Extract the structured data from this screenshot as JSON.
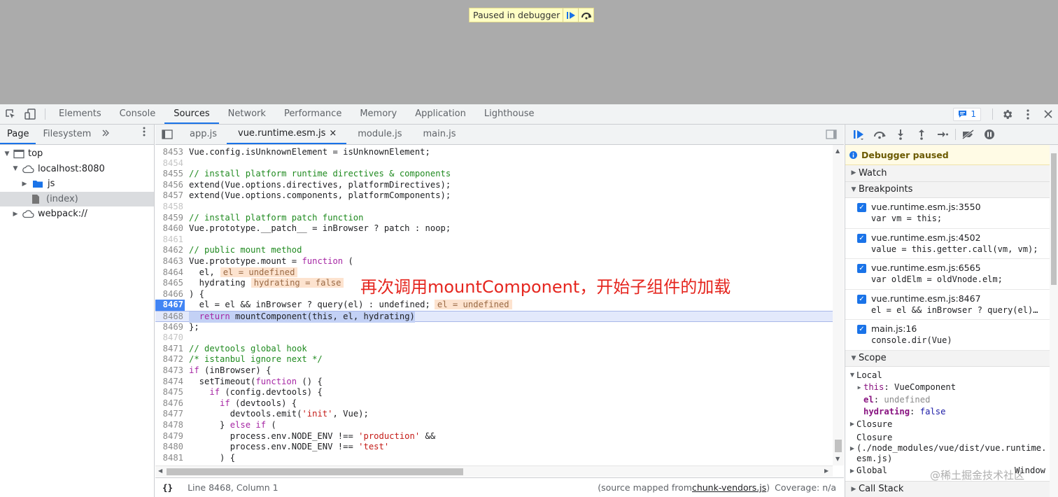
{
  "page": {
    "paused_label": "Paused in debugger"
  },
  "devtools": {
    "tabs": [
      "Elements",
      "Console",
      "Sources",
      "Network",
      "Performance",
      "Memory",
      "Application",
      "Lighthouse"
    ],
    "issues_count": "1"
  },
  "navigator": {
    "tabs": [
      "Page",
      "Filesystem"
    ],
    "tree": {
      "top": "top",
      "host": "localhost:8080",
      "js": "js",
      "index": "(index)",
      "webpack": "webpack://"
    }
  },
  "editor": {
    "tabs": [
      "app.js",
      "vue.runtime.esm.js",
      "module.js",
      "main.js"
    ],
    "annotation": "再次调用mountComponent，开始子组件的加载",
    "inline_values": {
      "el": "el = undefined",
      "hydrating": "hydrating = false",
      "el_8467": "el = undefined"
    },
    "status": {
      "position": "Line 8468, Column 1",
      "mapped_prefix": "(source mapped from ",
      "mapped_file": "chunk-vendors.js",
      "mapped_suffix": ")",
      "coverage": "Coverage: n/a"
    }
  },
  "code_lines": [
    {
      "n": "8453",
      "t": "Vue.config.isUnknownElement = isUnknownElement;"
    },
    {
      "n": "8454",
      "t": ""
    },
    {
      "n": "8455",
      "t": "// install platform runtime directives & components"
    },
    {
      "n": "8456",
      "t": "extend(Vue.options.directives, platformDirectives);"
    },
    {
      "n": "8457",
      "t": "extend(Vue.options.components, platformComponents);"
    },
    {
      "n": "8458",
      "t": ""
    },
    {
      "n": "8459",
      "t": "// install platform patch function"
    },
    {
      "n": "8460",
      "t": "Vue.prototype.__patch__ = inBrowser ? patch : noop;"
    },
    {
      "n": "8461",
      "t": ""
    },
    {
      "n": "8462",
      "t": "// public mount method"
    },
    {
      "n": "8463",
      "t": "Vue.prototype.$mount = function ("
    },
    {
      "n": "8464",
      "t": "  el,"
    },
    {
      "n": "8465",
      "t": "  hydrating"
    },
    {
      "n": "8466",
      "t": ") {"
    },
    {
      "n": "8467",
      "t": "  el = el && inBrowser ? query(el) : undefined;"
    },
    {
      "n": "8468",
      "t": "  return mountComponent(this, el, hydrating)"
    },
    {
      "n": "8469",
      "t": "};"
    },
    {
      "n": "8470",
      "t": ""
    },
    {
      "n": "8471",
      "t": "// devtools global hook"
    },
    {
      "n": "8472",
      "t": "/* istanbul ignore next */"
    },
    {
      "n": "8473",
      "t": "if (inBrowser) {"
    },
    {
      "n": "8474",
      "t": "  setTimeout(function () {"
    },
    {
      "n": "8475",
      "t": "    if (config.devtools) {"
    },
    {
      "n": "8476",
      "t": "      if (devtools) {"
    },
    {
      "n": "8477",
      "t": "        devtools.emit('init', Vue);"
    },
    {
      "n": "8478",
      "t": "      } else if ("
    },
    {
      "n": "8479",
      "t": "        process.env.NODE_ENV !== 'production' &&"
    },
    {
      "n": "8480",
      "t": "        process.env.NODE_ENV !== 'test'"
    },
    {
      "n": "8481",
      "t": "      ) {"
    }
  ],
  "debugger": {
    "paused_message": "Debugger paused",
    "sections": {
      "watch": "Watch",
      "breakpoints": "Breakpoints",
      "scope": "Scope",
      "call_stack": "Call Stack"
    },
    "breakpoints": [
      {
        "loc": "vue.runtime.esm.js:3550",
        "code": "var vm = this;"
      },
      {
        "loc": "vue.runtime.esm.js:4502",
        "code": "value = this.getter.call(vm, vm);"
      },
      {
        "loc": "vue.runtime.esm.js:6565",
        "code": "var oldElm = oldVnode.elm;"
      },
      {
        "loc": "vue.runtime.esm.js:8467",
        "code": "el = el && inBrowser ? query(el)…"
      },
      {
        "loc": "main.js:16",
        "code": "console.dir(Vue)"
      }
    ],
    "scope": {
      "local": "Local",
      "this_name": "this",
      "this_value": "VueComponent",
      "el_name": "el",
      "el_value": "undefined",
      "hyd_name": "hydrating",
      "hyd_value": "false",
      "closure1": "Closure",
      "closure2": "Closure",
      "closure2_detail_a": "(./node_modules/vue/dist/vue.runtime.",
      "closure2_detail_b": "esm.js)",
      "global": "Global",
      "global_value": "Window"
    }
  },
  "watermark": "@稀土掘金技术社区"
}
